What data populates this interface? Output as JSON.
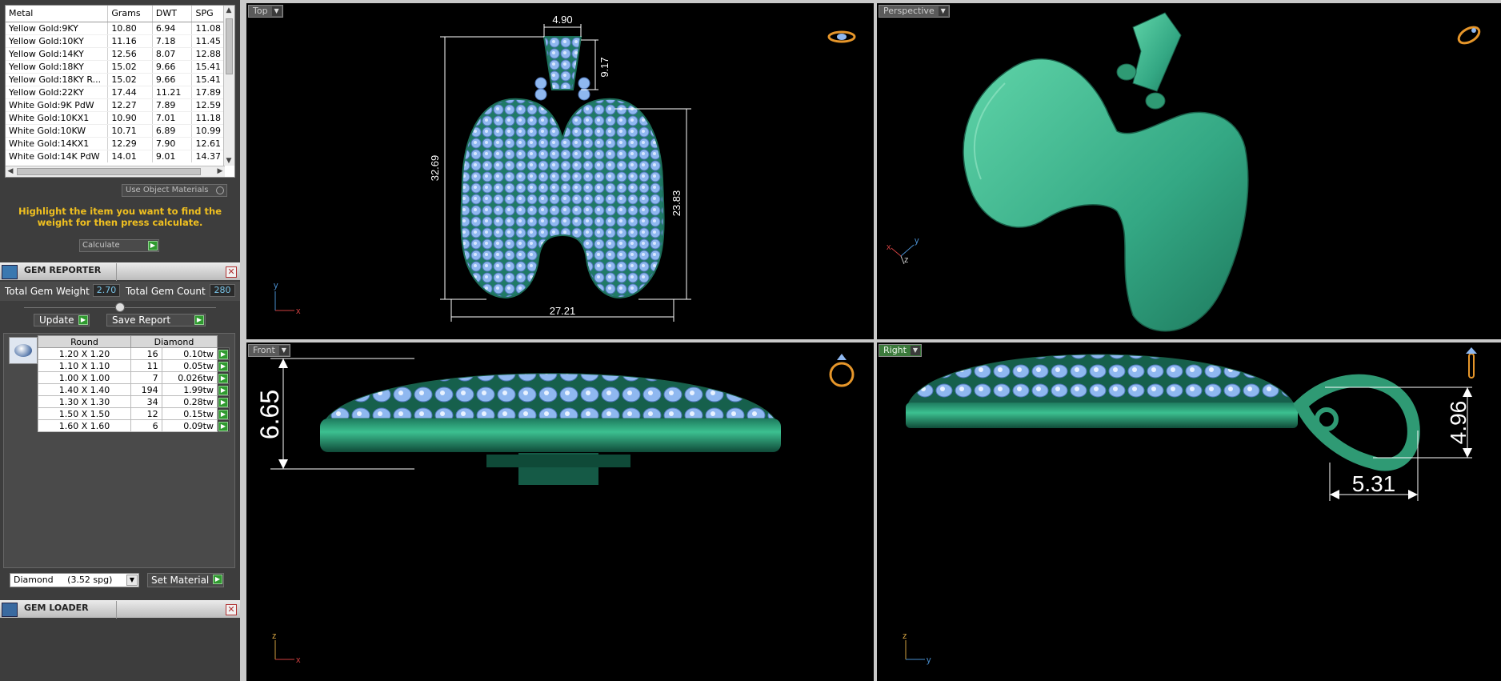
{
  "metal_table": {
    "headers": [
      "Metal",
      "Grams",
      "DWT",
      "SPG"
    ],
    "rows": [
      [
        "Yellow Gold:9KY",
        "10.80",
        "6.94",
        "11.08"
      ],
      [
        "Yellow Gold:10KY",
        "11.16",
        "7.18",
        "11.45"
      ],
      [
        "Yellow Gold:14KY",
        "12.56",
        "8.07",
        "12.88"
      ],
      [
        "Yellow Gold:18KY",
        "15.02",
        "9.66",
        "15.41"
      ],
      [
        "Yellow Gold:18KY R...",
        "15.02",
        "9.66",
        "15.41"
      ],
      [
        "Yellow Gold:22KY",
        "17.44",
        "11.21",
        "17.89"
      ],
      [
        "White Gold:9K PdW",
        "12.27",
        "7.89",
        "12.59"
      ],
      [
        "White Gold:10KX1",
        "10.90",
        "7.01",
        "11.18"
      ],
      [
        "White Gold:10KW",
        "10.71",
        "6.89",
        "10.99"
      ],
      [
        "White Gold:14KX1",
        "12.29",
        "7.90",
        "12.61"
      ],
      [
        "White Gold:14K PdW",
        "14.01",
        "9.01",
        "14.37"
      ]
    ]
  },
  "use_object_materials": "Use Object Materials",
  "hint_text": "Highlight the item you want to find the weight for then press calculate.",
  "calculate_label": "Calculate",
  "gem_reporter": {
    "title": "GEM REPORTER",
    "total_weight_label": "Total Gem Weight",
    "total_weight_value": "2.70",
    "total_count_label": "Total Gem Count",
    "total_count_value": "280",
    "update_label": "Update",
    "save_label": "Save Report",
    "table_headers": [
      "Round",
      "Diamond"
    ],
    "rows": [
      [
        "1.20 X 1.20",
        "16",
        "0.10tw"
      ],
      [
        "1.10 X 1.10",
        "11",
        "0.05tw"
      ],
      [
        "1.00 X 1.00",
        "7",
        "0.026tw"
      ],
      [
        "1.40 X 1.40",
        "194",
        "1.99tw"
      ],
      [
        "1.30 X 1.30",
        "34",
        "0.28tw"
      ],
      [
        "1.50 X 1.50",
        "12",
        "0.15tw"
      ],
      [
        "1.60 X 1.60",
        "6",
        "0.09tw"
      ]
    ],
    "material_select": "Diamond     (3.52 spg)",
    "set_material_label": "Set Material"
  },
  "gem_loader": {
    "title": "GEM LOADER"
  },
  "viewports": {
    "top": {
      "label": "Top",
      "dims": {
        "top_width": "4.90",
        "bail_height": "9.17",
        "total_height": "32.69",
        "body_height": "23.83",
        "width": "27.21"
      },
      "axis_y": "y",
      "axis_x": "x"
    },
    "perspective": {
      "label": "Perspective",
      "axis_y": "y",
      "axis_x": "x",
      "axis_z": "z"
    },
    "front": {
      "label": "Front",
      "dims": {
        "thickness": "6.65"
      },
      "axis_z": "z",
      "axis_x": "x"
    },
    "right": {
      "label": "Right",
      "dims": {
        "bail_height": "4.96",
        "bail_width": "5.31"
      },
      "axis_z": "z",
      "axis_y": "y"
    }
  },
  "colors": {
    "metal_green": "#2f9a74",
    "gem_blue": "#8fb8f0",
    "hint_yellow": "#f0c020",
    "dimension_white": "#ffffff"
  }
}
